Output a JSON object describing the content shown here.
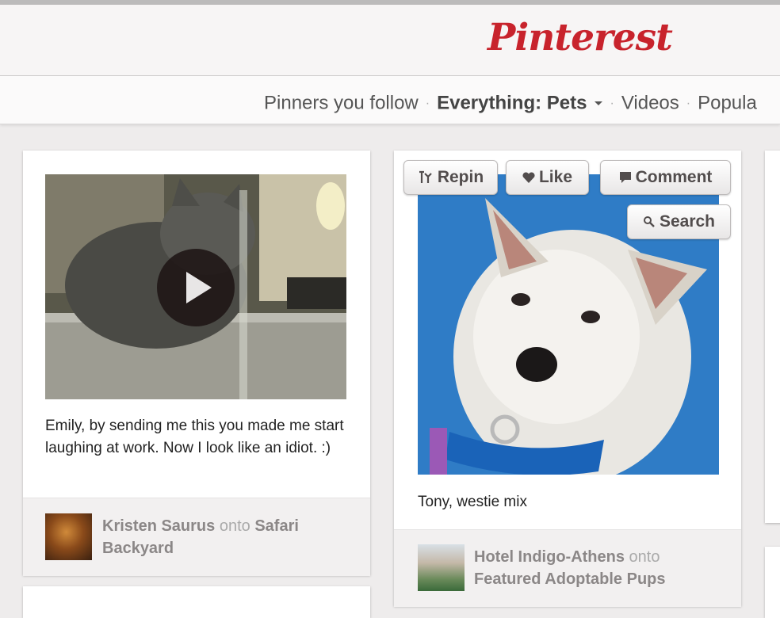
{
  "brand": {
    "logo_text": "Pinterest",
    "accent_color": "#c8232c"
  },
  "nav": {
    "items": [
      {
        "label": "Pinners you follow",
        "active": false
      },
      {
        "label": "Everything: Pets",
        "active": true,
        "dropdown": true
      },
      {
        "label": "Videos",
        "active": false
      },
      {
        "label": "Popula",
        "active": false
      }
    ],
    "separator": "·"
  },
  "pins": [
    {
      "media": "video",
      "play_icon": "play-icon",
      "caption": "Emily, by sending me this you made me start laughing at work. Now I look like an idiot. :)",
      "pinner": "Kristen Saurus",
      "onto": "onto",
      "board": "Safari Backyard"
    },
    {
      "media": "image",
      "caption": "Tony, westie mix",
      "pinner": "Hotel Indigo-Athens",
      "onto": "onto",
      "board": "Featured Adoptable Pups",
      "actions": {
        "repin": "Repin",
        "like": "Like",
        "comment": "Comment",
        "search": "Search"
      }
    }
  ]
}
